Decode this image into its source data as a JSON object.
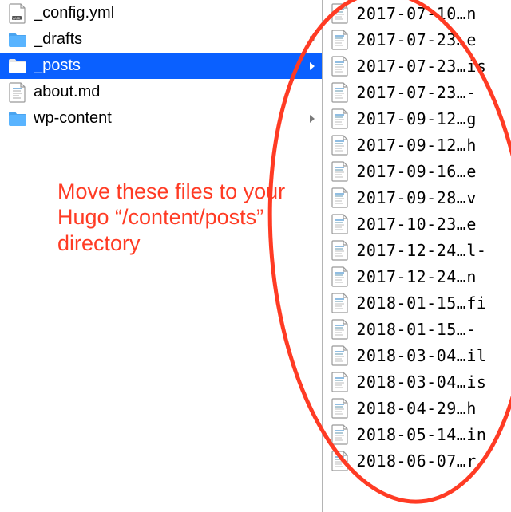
{
  "left": {
    "items": [
      {
        "name": "_config.yml",
        "kind": "yaml",
        "folder": false,
        "selected": false
      },
      {
        "name": "_drafts",
        "kind": "folder",
        "folder": true,
        "selected": false
      },
      {
        "name": "_posts",
        "kind": "folder",
        "folder": true,
        "selected": true
      },
      {
        "name": "about.md",
        "kind": "md",
        "folder": false,
        "selected": false
      },
      {
        "name": "wp-content",
        "kind": "folder",
        "folder": true,
        "selected": false
      }
    ]
  },
  "right": {
    "items": [
      {
        "name": "2017-07-10…n"
      },
      {
        "name": "2017-07-23…e"
      },
      {
        "name": "2017-07-23…is"
      },
      {
        "name": "2017-07-23…-"
      },
      {
        "name": "2017-09-12…g"
      },
      {
        "name": "2017-09-12…h"
      },
      {
        "name": "2017-09-16…e"
      },
      {
        "name": "2017-09-28…v"
      },
      {
        "name": "2017-10-23…e"
      },
      {
        "name": "2017-12-24…l-"
      },
      {
        "name": "2017-12-24…n"
      },
      {
        "name": "2018-01-15…fi"
      },
      {
        "name": "2018-01-15…-"
      },
      {
        "name": "2018-03-04…il"
      },
      {
        "name": "2018-03-04…is"
      },
      {
        "name": "2018-04-29…h"
      },
      {
        "name": "2018-05-14…in"
      },
      {
        "name": "2018-06-07…r"
      }
    ]
  },
  "annotation": {
    "text": "Move these files to your Hugo “/content/posts” directory",
    "color": "#ff3b24"
  }
}
